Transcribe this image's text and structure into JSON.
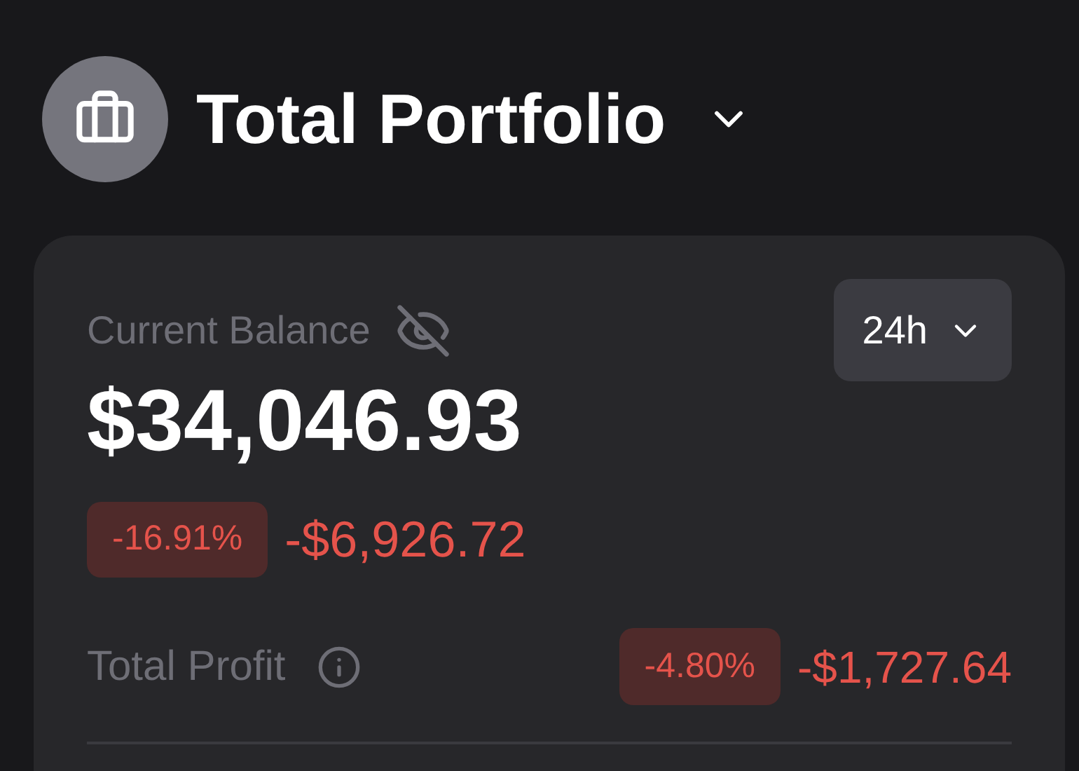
{
  "header": {
    "title": "Total Portfolio"
  },
  "balance": {
    "label": "Current Balance",
    "period": "24h",
    "value": "$34,046.93",
    "change": {
      "kind": "loss",
      "percent": "-16.91%",
      "amount": "-$6,926.72"
    }
  },
  "profit": {
    "label": "Total Profit",
    "kind": "loss",
    "percent": "-4.80%",
    "amount": "-$1,727.64"
  }
}
